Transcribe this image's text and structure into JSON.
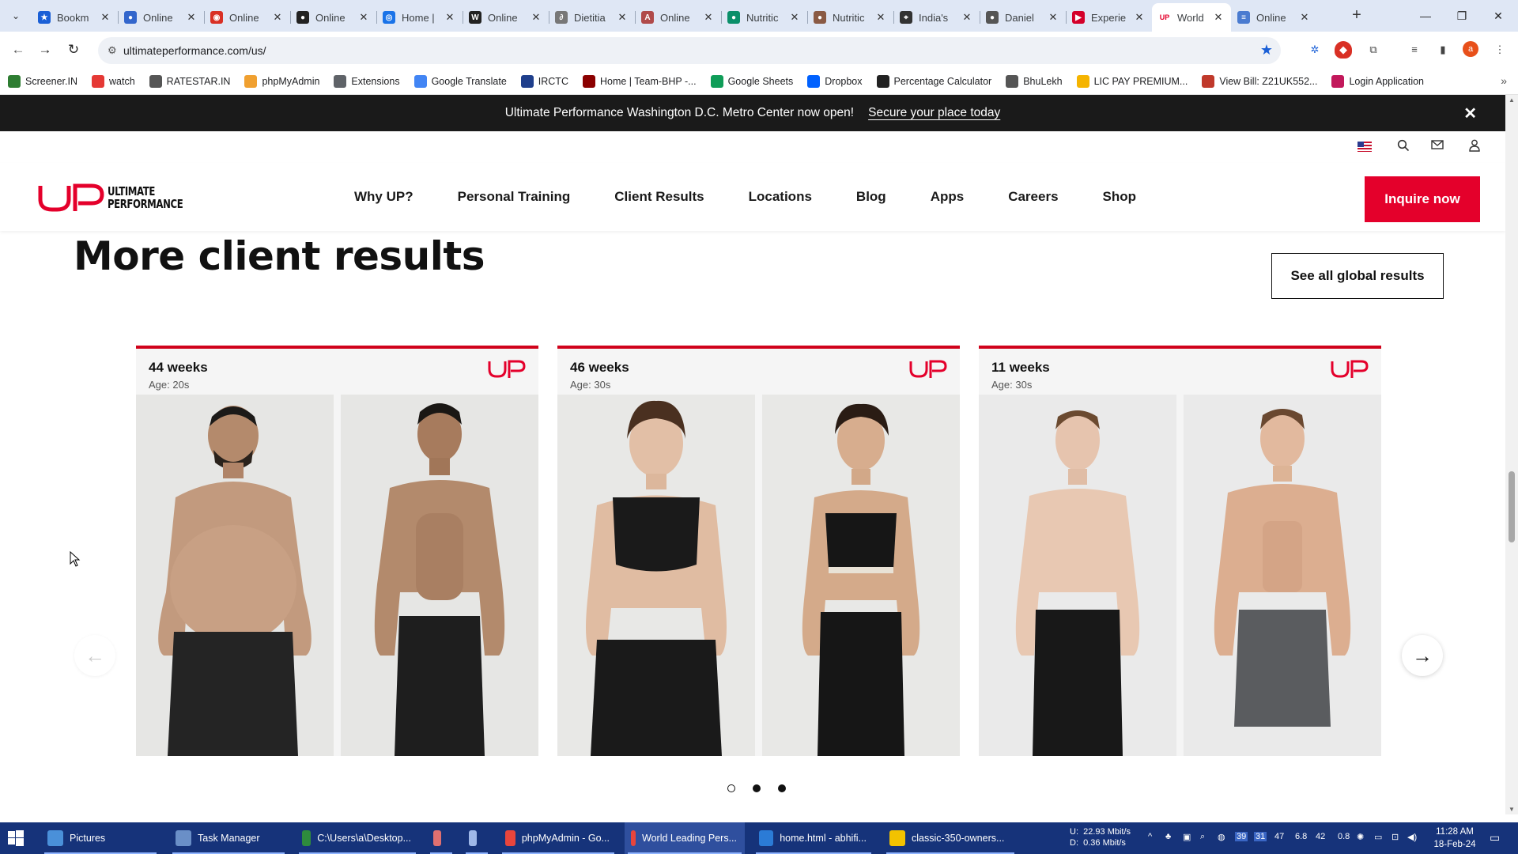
{
  "browser": {
    "tabs": [
      {
        "title": "Bookm",
        "color": "#1a5fd6",
        "glyph": "★"
      },
      {
        "title": "Online",
        "color": "#3366cc",
        "glyph": "●"
      },
      {
        "title": "Online",
        "color": "#d93025",
        "glyph": "◉"
      },
      {
        "title": "Online",
        "color": "#222222",
        "glyph": "●"
      },
      {
        "title": "Home |",
        "color": "#1a73e8",
        "glyph": "◎"
      },
      {
        "title": "Online",
        "color": "#222222",
        "glyph": "W"
      },
      {
        "title": "Dietitia",
        "color": "#777777",
        "glyph": "∂"
      },
      {
        "title": "Online",
        "color": "#b04a4a",
        "glyph": "A"
      },
      {
        "title": "Nutritic",
        "color": "#0a8f6a",
        "glyph": "●"
      },
      {
        "title": "Nutritic",
        "color": "#8a5a44",
        "glyph": "●"
      },
      {
        "title": "India's",
        "color": "#333333",
        "glyph": "⌖"
      },
      {
        "title": "Daniel",
        "color": "#555555",
        "glyph": "●"
      },
      {
        "title": "Experie",
        "color": "#d4002a",
        "glyph": "▶"
      },
      {
        "title": "World",
        "color": "#e4002b",
        "glyph": "UP",
        "active": true
      },
      {
        "title": "Online",
        "color": "#4a7bd0",
        "glyph": "≡"
      }
    ],
    "url": "ultimateperformance.com/us/",
    "bookmarks": [
      {
        "label": "Screener.IN",
        "color": "#2e7d32"
      },
      {
        "label": "watch",
        "color": "#e53935"
      },
      {
        "label": "RATESTAR.IN",
        "color": "#555555"
      },
      {
        "label": "phpMyAdmin",
        "color": "#f0a030"
      },
      {
        "label": "Extensions",
        "color": "#5f6368"
      },
      {
        "label": "Google Translate",
        "color": "#4285f4"
      },
      {
        "label": "IRCTC",
        "color": "#1f3f8c"
      },
      {
        "label": "Home | Team-BHP -...",
        "color": "#8b0000"
      },
      {
        "label": "Google Sheets",
        "color": "#0f9d58"
      },
      {
        "label": "Dropbox",
        "color": "#0061fe"
      },
      {
        "label": "Percentage Calculator",
        "color": "#222222"
      },
      {
        "label": "BhuLekh",
        "color": "#555555"
      },
      {
        "label": "LIC PAY PREMIUM...",
        "color": "#f5b400"
      },
      {
        "label": "View Bill: Z21UK552...",
        "color": "#c0392b"
      },
      {
        "label": "Login Application",
        "color": "#c2185b"
      }
    ]
  },
  "site": {
    "announcement": {
      "text": "Ultimate Performance Washington D.C. Metro Center now open!",
      "link": "Secure your place today"
    },
    "logo_text": {
      "line1": "ULTIMATE",
      "line2": "PERFORMANCE"
    },
    "nav": [
      "Why UP?",
      "Personal Training",
      "Client Results",
      "Locations",
      "Blog",
      "Apps",
      "Careers",
      "Shop"
    ],
    "cta": "Inquire now",
    "section_title": "More client results",
    "see_all": "See all global results",
    "results": [
      {
        "weeks": "44 weeks",
        "age": "Age: 20s"
      },
      {
        "weeks": "46 weeks",
        "age": "Age: 30s"
      },
      {
        "weeks": "11 weeks",
        "age": "Age: 30s"
      }
    ],
    "brand_color": "#e4002b",
    "carousel_page": 1,
    "carousel_pages": 3
  },
  "taskbar": {
    "apps": [
      {
        "label": "Pictures",
        "color": "#4a90d9"
      },
      {
        "label": "Task Manager",
        "color": "#6a8fc7"
      },
      {
        "label": "C:\\Users\\a\\Desktop...",
        "color": "#2e8b3d"
      },
      {
        "label": "",
        "color": "#e07070"
      },
      {
        "label": "",
        "color": "#9fb8e8"
      },
      {
        "label": "phpMyAdmin - Go...",
        "color": "#e8453c"
      },
      {
        "label": "World Leading Pers...",
        "color": "#e8453c"
      },
      {
        "label": "home.html - abhifi...",
        "color": "#2b7bd6"
      },
      {
        "label": "classic-350-owners...",
        "color": "#f2c200"
      }
    ],
    "net_up": "22.93 Mbit/s",
    "net_down": "0.36 Mbit/s",
    "net_labels": {
      "up": "U:",
      "down": "D:"
    },
    "tray_numbers": [
      "39",
      "31",
      "47",
      "6.8",
      "42",
      "0.8"
    ],
    "time": "11:28 AM",
    "date": "18-Feb-24"
  }
}
